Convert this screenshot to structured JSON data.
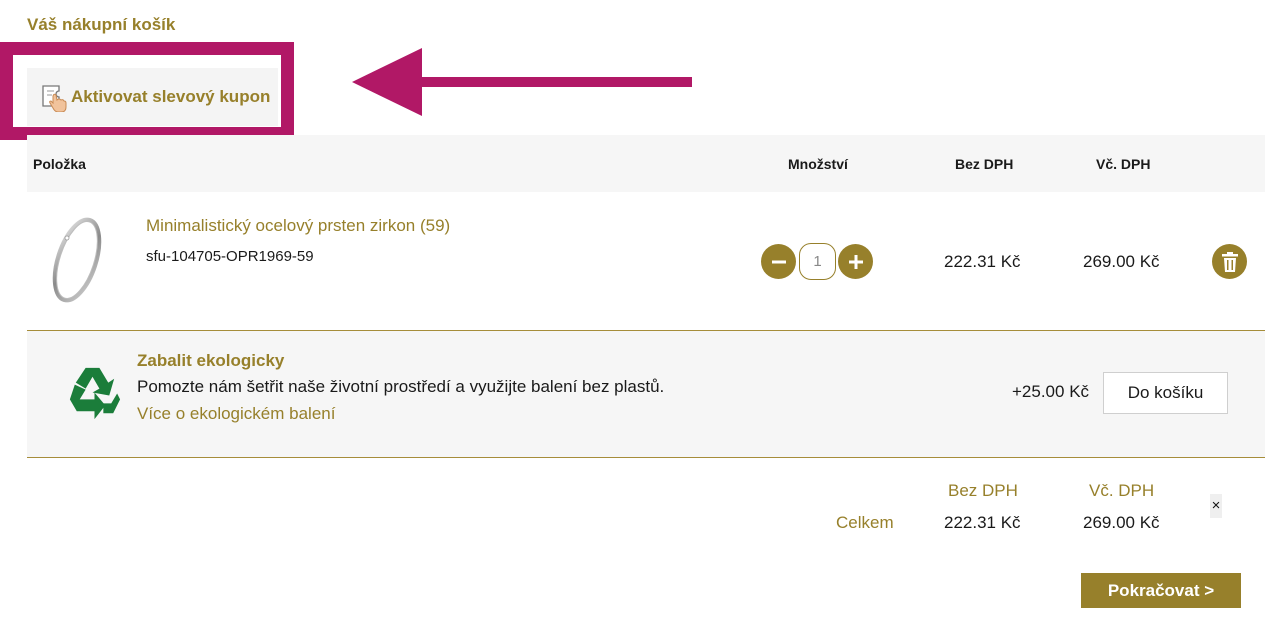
{
  "cart": {
    "title": "Váš nákupní košík"
  },
  "coupon": {
    "label": "Aktivovat slevový kupon",
    "icon": "coupon-hand-icon"
  },
  "annotation": {
    "color": "#b11866"
  },
  "table": {
    "headers": {
      "item": "Položka",
      "quantity": "Množství",
      "price_excl_vat": "Bez DPH",
      "price_incl_vat": "Vč. DPH"
    }
  },
  "item": {
    "name": "Minimalistický ocelový prsten zirkon (59)",
    "sku": "sfu-104705-OPR1969-59",
    "quantity": "1",
    "price_excl_vat": "222.31 Kč",
    "price_incl_vat": "269.00 Kč",
    "image": "ring-image"
  },
  "eco": {
    "title": "Zabalit ekologicky",
    "text": "Pomozte nám šetřit naše životní prostředí a využijte balení bez plastů.",
    "link": "Více o ekologickém balení",
    "price": "+25.00 Kč",
    "add_label": "Do košíku",
    "icon": "recycle-icon"
  },
  "summary": {
    "head_excl": "Bez DPH",
    "head_incl": "Vč. DPH",
    "label": "Celkem",
    "total_excl": "222.31 Kč",
    "total_incl": "269.00 Kč",
    "close": "×"
  },
  "actions": {
    "continue_label": "Pokračovat >"
  },
  "colors": {
    "accent": "#97802b",
    "highlight": "#b11866",
    "eco_green": "#1b7d3a"
  }
}
